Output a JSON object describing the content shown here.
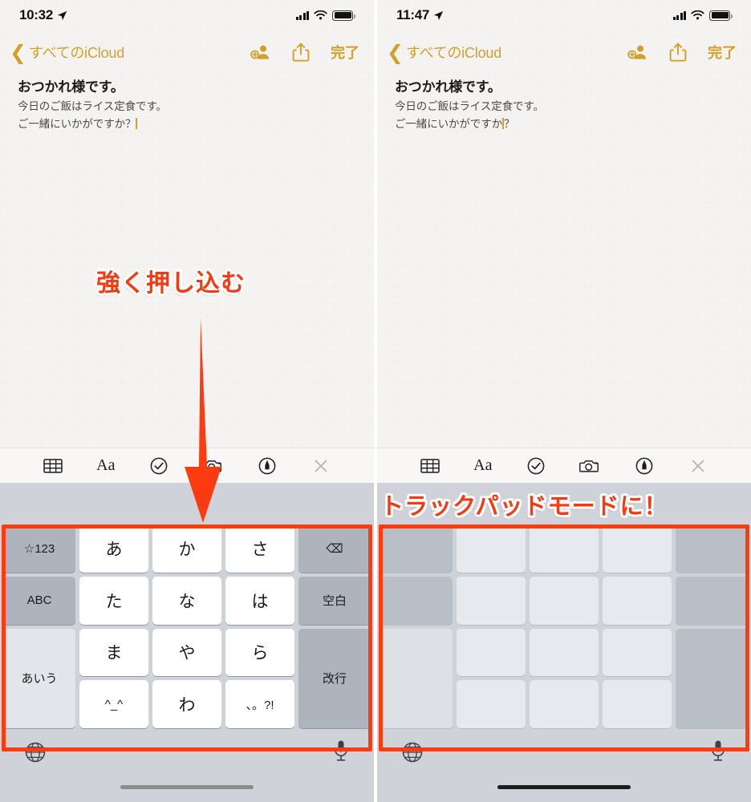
{
  "panels": {
    "left": {
      "status": {
        "time": "10:32",
        "location_icon": "location-arrow-icon",
        "signal_icon": "cellular-signal-icon",
        "wifi_icon": "wifi-icon",
        "battery_icon": "battery-full-icon"
      },
      "nav": {
        "back_label": "すべてのiCloud",
        "back_icon": "chevron-left-icon",
        "add_person_icon": "add-person-icon",
        "share_icon": "share-icon",
        "done_label": "完了"
      },
      "note": {
        "title": "おつかれ様です。",
        "line1": "今日のご飯はライス定食です。",
        "line2": "ご一緒にいかがですか？"
      },
      "keyboard_mode": "kana"
    },
    "right": {
      "status": {
        "time": "11:47",
        "location_icon": "location-arrow-icon",
        "signal_icon": "cellular-signal-icon",
        "wifi_icon": "wifi-icon",
        "battery_icon": "battery-full-icon"
      },
      "nav": {
        "back_label": "すべてのiCloud",
        "back_icon": "chevron-left-icon",
        "add_person_icon": "add-person-icon",
        "share_icon": "share-icon",
        "done_label": "完了"
      },
      "note": {
        "title": "おつかれ様です。",
        "line1": "今日のご飯はライス定食です。",
        "line2a": "ご一緒にいかがですか",
        "line2b": "？"
      },
      "keyboard_mode": "trackpad"
    }
  },
  "format_toolbar": {
    "items": [
      {
        "name": "table-icon",
        "label": ""
      },
      {
        "name": "text-format-icon",
        "label": "Aa"
      },
      {
        "name": "checklist-icon",
        "label": ""
      },
      {
        "name": "camera-icon",
        "label": ""
      },
      {
        "name": "markup-pen-icon",
        "label": ""
      },
      {
        "name": "close-icon",
        "label": ""
      }
    ]
  },
  "keyboard": {
    "rows": [
      [
        {
          "label": "☆123",
          "type": "fn"
        },
        {
          "label": "あ",
          "type": "char"
        },
        {
          "label": "か",
          "type": "char"
        },
        {
          "label": "さ",
          "type": "char"
        },
        {
          "label": "⌫",
          "type": "fn"
        }
      ],
      [
        {
          "label": "ABC",
          "type": "fn"
        },
        {
          "label": "た",
          "type": "char"
        },
        {
          "label": "な",
          "type": "char"
        },
        {
          "label": "は",
          "type": "char"
        },
        {
          "label": "空白",
          "type": "fn"
        }
      ],
      [
        {
          "label": "あいう",
          "type": "fn-light",
          "span": 2
        },
        {
          "label": "ま",
          "type": "char"
        },
        {
          "label": "や",
          "type": "char"
        },
        {
          "label": "ら",
          "type": "char"
        },
        {
          "label": "改行",
          "type": "fn",
          "span": 2
        }
      ],
      [
        {
          "label": "^_^",
          "type": "char"
        },
        {
          "label": "わ",
          "type": "char"
        },
        {
          "label": "、。?!",
          "type": "char"
        }
      ]
    ],
    "bottom": {
      "globe_icon": "globe-icon",
      "mic_icon": "microphone-icon"
    }
  },
  "annotations": {
    "press_hard": "強く押し込む",
    "trackpad_mode": "トラックパッドモードに！",
    "arrow": "down-arrow-annotation",
    "highlight_color": "#fc3b10",
    "text_color": "#f53a12"
  }
}
